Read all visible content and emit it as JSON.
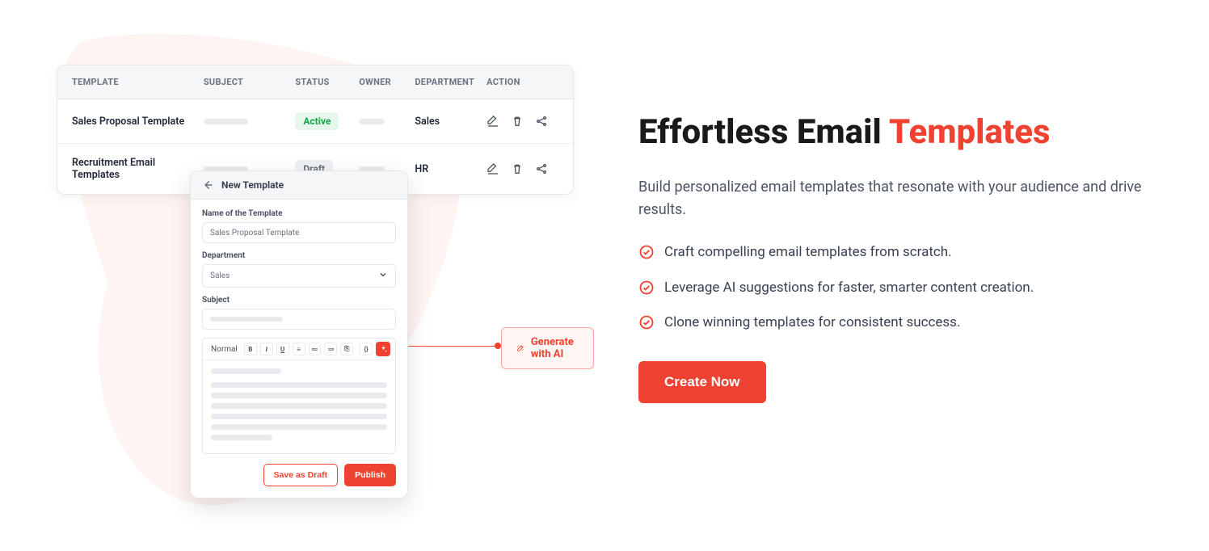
{
  "table": {
    "headers": {
      "template": "TEMPLATE",
      "subject": "SUBJECT",
      "status": "STATUS",
      "owner": "OWNER",
      "department": "DEPARTMENT",
      "action": "ACTION"
    },
    "rows": [
      {
        "template": "Sales Proposal Template",
        "status": "Active",
        "status_class": "active",
        "department": "Sales"
      },
      {
        "template": "Recruitment Email Templates",
        "status": "Draft",
        "status_class": "draft",
        "department": "HR"
      }
    ]
  },
  "modal": {
    "title": "New Template",
    "name_label": "Name of the Template",
    "name_value": "Sales Proposal Template",
    "dept_label": "Department",
    "dept_value": "Sales",
    "subject_label": "Subject",
    "editor_format": "Normal",
    "save_draft": "Save as Draft",
    "publish": "Publish"
  },
  "generate_ai": "Generate with AI",
  "hero": {
    "title_plain": "Effortless Email ",
    "title_accent": "Templates",
    "lead": "Build personalized email templates that resonate with your audience and drive results.",
    "bullets": [
      "Craft compelling email templates from scratch.",
      "Leverage AI suggestions for faster, smarter content creation.",
      "Clone winning templates for consistent success."
    ],
    "cta": "Create Now"
  }
}
